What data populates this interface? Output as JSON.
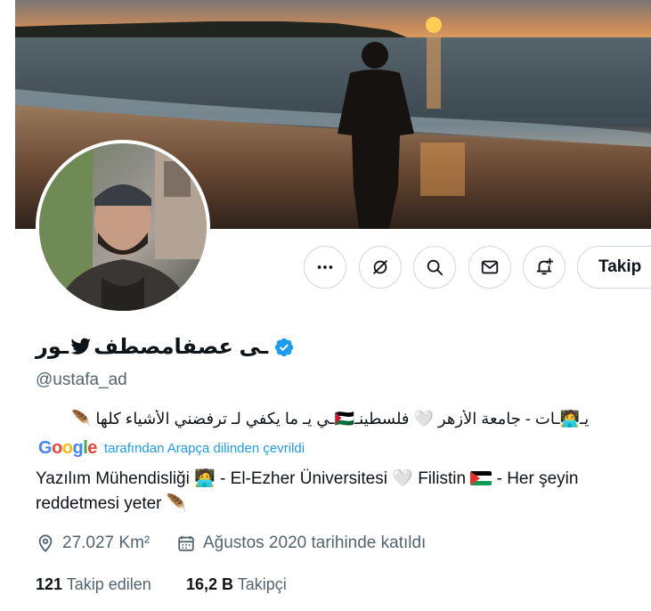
{
  "profile": {
    "display_name_part1": "ـور",
    "display_name_part2": "ـى عصفامصطف",
    "handle": "@ustafa_ad",
    "verified": true,
    "bio_original": "يـ🧑‍💻ـات - جامعة الأزهر 🤍 فلسطينـ🇵🇸ـي يـ ما يكفي لـ ترفضني الأشياء كلها 🪶",
    "translate_label": "tarafından Arapça dilinden çevrildi",
    "translate_brand": [
      "G",
      "o",
      "o",
      "g",
      "l",
      "e"
    ],
    "bio_translated_line1": "Yazılım Mühendisliği 🧑‍💻 - El-Ezher Üniversitesi 🤍 Filistin",
    "bio_translated_line1_end": "- Her şeyin",
    "bio_translated_line2": "reddetmesi yeter 🪶",
    "location": "27.027 Km²",
    "joined": "Ağustos 2020 tarihinde katıldı",
    "following_count": "121",
    "following_label": "Takip edilen",
    "followers_count": "16,2 B",
    "followers_label": "Takipçi"
  },
  "actions": {
    "more_icon": "more-horizontal-icon",
    "grok_icon": "grok-icon",
    "search_icon": "search-icon",
    "message_icon": "mail-icon",
    "notify_icon": "bell-plus-icon",
    "follow_label": "Takip"
  },
  "colors": {
    "accent": "#1d9bf0",
    "verified": "#1d9bf0",
    "text": "#0f1419",
    "secondary": "#536471",
    "border": "#cfd9de"
  }
}
